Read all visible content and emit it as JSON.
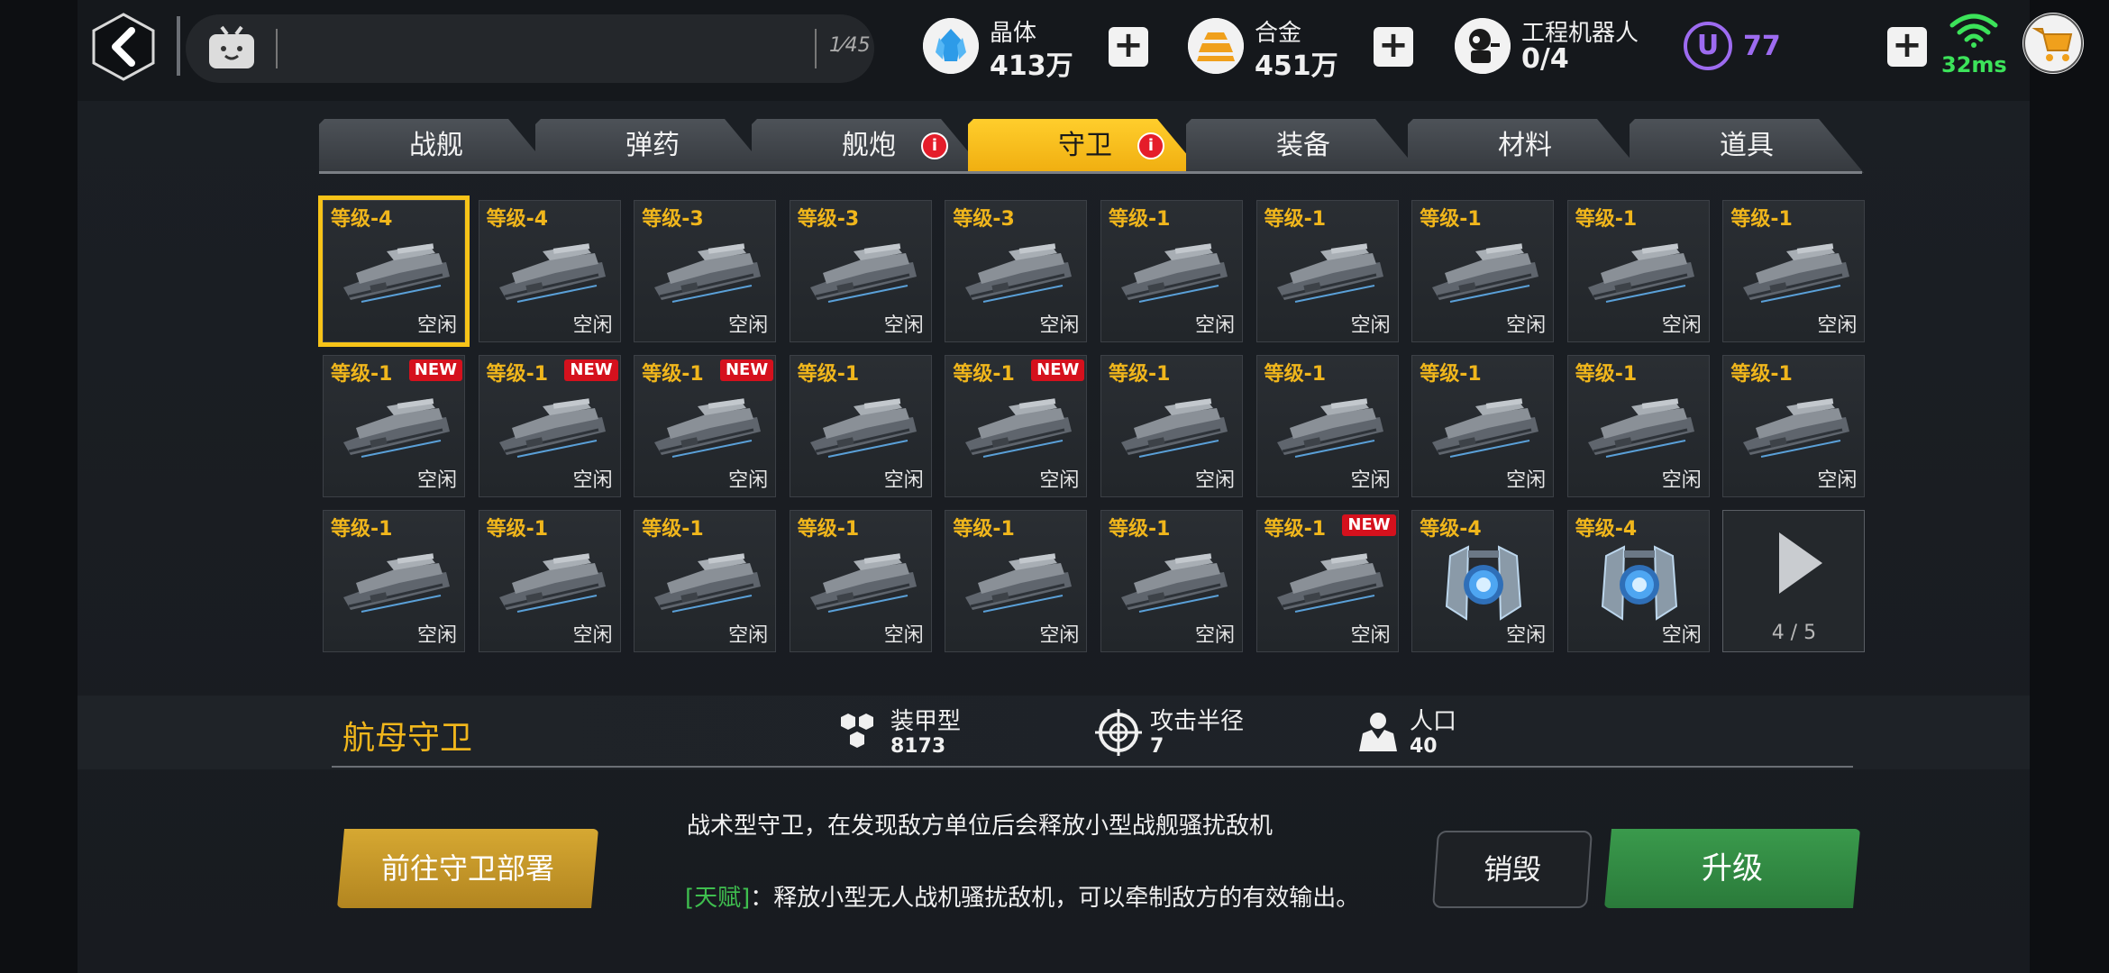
{
  "topbar": {
    "chat_count": "1⁄45",
    "resources": [
      {
        "name": "crystal",
        "label": "晶体",
        "value": "413万",
        "icon": "crystal-icon"
      },
      {
        "name": "alloy",
        "label": "合金",
        "value": "451万",
        "icon": "alloy-icon"
      },
      {
        "name": "engineer-robot",
        "label": "工程机器人",
        "value": "0/4",
        "icon": "robot-icon"
      }
    ],
    "u_coin_symbol": "U",
    "u_coin_value": "77",
    "ping": "32ms",
    "colors": {
      "ping": "#3ce35a",
      "u_coin": "#9d6bf0",
      "accent": "#f7c318"
    }
  },
  "tabs": [
    {
      "label": "战舰",
      "active": false
    },
    {
      "label": "弹药",
      "active": false
    },
    {
      "label": "舰炮",
      "active": false,
      "alert": "i"
    },
    {
      "label": "守卫",
      "active": true,
      "alert": "i"
    },
    {
      "label": "装备",
      "active": false
    },
    {
      "label": "材料",
      "active": false
    },
    {
      "label": "道具",
      "active": false
    }
  ],
  "grid": {
    "items": [
      {
        "level": "等级-4",
        "status": "空闲",
        "new": "",
        "art": "turret",
        "selected": true
      },
      {
        "level": "等级-4",
        "status": "空闲",
        "new": "",
        "art": "turret"
      },
      {
        "level": "等级-3",
        "status": "空闲",
        "new": "",
        "art": "turret"
      },
      {
        "level": "等级-3",
        "status": "空闲",
        "new": "",
        "art": "turret"
      },
      {
        "level": "等级-3",
        "status": "空闲",
        "new": "",
        "art": "turret"
      },
      {
        "level": "等级-1",
        "status": "空闲",
        "new": "",
        "art": "turret"
      },
      {
        "level": "等级-1",
        "status": "空闲",
        "new": "",
        "art": "turret"
      },
      {
        "level": "等级-1",
        "status": "空闲",
        "new": "",
        "art": "turret"
      },
      {
        "level": "等级-1",
        "status": "空闲",
        "new": "",
        "art": "turret"
      },
      {
        "level": "等级-1",
        "status": "空闲",
        "new": "",
        "art": "turret"
      },
      {
        "level": "等级-1",
        "status": "空闲",
        "new": "NEW",
        "art": "turret"
      },
      {
        "level": "等级-1",
        "status": "空闲",
        "new": "NEW",
        "art": "turret"
      },
      {
        "level": "等级-1",
        "status": "空闲",
        "new": "NEW",
        "art": "turret"
      },
      {
        "level": "等级-1",
        "status": "空闲",
        "new": "",
        "art": "turret"
      },
      {
        "level": "等级-1",
        "status": "空闲",
        "new": "NEW",
        "art": "turret"
      },
      {
        "level": "等级-1",
        "status": "空闲",
        "new": "",
        "art": "turret"
      },
      {
        "level": "等级-1",
        "status": "空闲",
        "new": "",
        "art": "turret"
      },
      {
        "level": "等级-1",
        "status": "空闲",
        "new": "",
        "art": "turret"
      },
      {
        "level": "等级-1",
        "status": "空闲",
        "new": "",
        "art": "turret"
      },
      {
        "level": "等级-1",
        "status": "空闲",
        "new": "",
        "art": "turret"
      },
      {
        "level": "等级-1",
        "status": "空闲",
        "new": "",
        "art": "turret"
      },
      {
        "level": "等级-1",
        "status": "空闲",
        "new": "",
        "art": "turret"
      },
      {
        "level": "等级-1",
        "status": "空闲",
        "new": "",
        "art": "turret"
      },
      {
        "level": "等级-1",
        "status": "空闲",
        "new": "",
        "art": "turret"
      },
      {
        "level": "等级-1",
        "status": "空闲",
        "new": "",
        "art": "turret"
      },
      {
        "level": "等级-1",
        "status": "空闲",
        "new": "",
        "art": "turret"
      },
      {
        "level": "等级-1",
        "status": "空闲",
        "new": "NEW",
        "art": "turret"
      },
      {
        "level": "等级-4",
        "status": "空闲",
        "new": "",
        "art": "shield"
      },
      {
        "level": "等级-4",
        "status": "空闲",
        "new": "",
        "art": "shield"
      }
    ],
    "page": "4 / 5"
  },
  "detail": {
    "name": "航母守卫",
    "stats": [
      {
        "label": "装甲型",
        "value": "8173",
        "icon": "armor-hex-icon"
      },
      {
        "label": "攻击半径",
        "value": "7",
        "icon": "crosshair-icon"
      },
      {
        "label": "人口",
        "value": "40",
        "icon": "population-icon"
      }
    ],
    "description": "战术型守卫，在发现敌方单位后会释放小型战舰骚扰敌机",
    "talent_tag": "[天赋]",
    "talent_text": "：释放小型无人战机骚扰敌机，可以牵制敌方的有效输出。",
    "deploy_label": "前往守卫部署",
    "destroy_label": "销毁",
    "upgrade_label": "升级"
  }
}
